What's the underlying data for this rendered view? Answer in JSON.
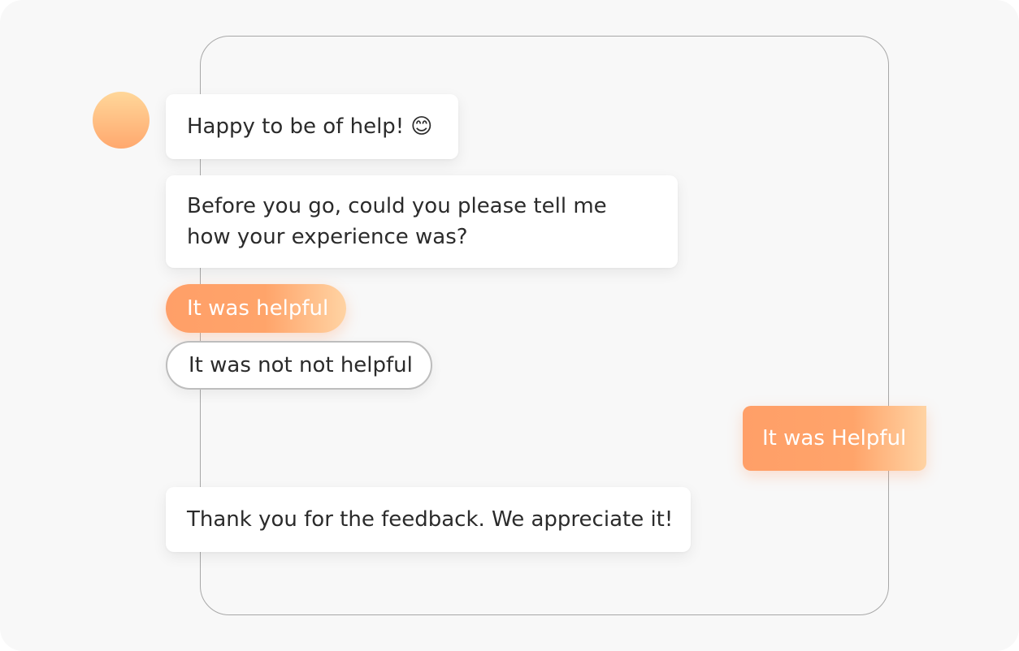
{
  "chat": {
    "messages": {
      "greeting": "Happy to be of help!",
      "greeting_emoji": "😊",
      "question": "Before you go, could you please tell me how your experience was?",
      "thanks": "Thank you for the feedback. We appreciate it!"
    },
    "quick_replies": {
      "helpful": "It was helpful",
      "not_helpful": "It was not not helpful"
    },
    "user_reply": "It was Helpful"
  },
  "colors": {
    "accent_start": "#ff9f68",
    "accent_end": "#ffd3a3",
    "background": "#f8f8f8",
    "bubble": "#ffffff"
  },
  "icons": {
    "avatar": "bot-avatar"
  }
}
